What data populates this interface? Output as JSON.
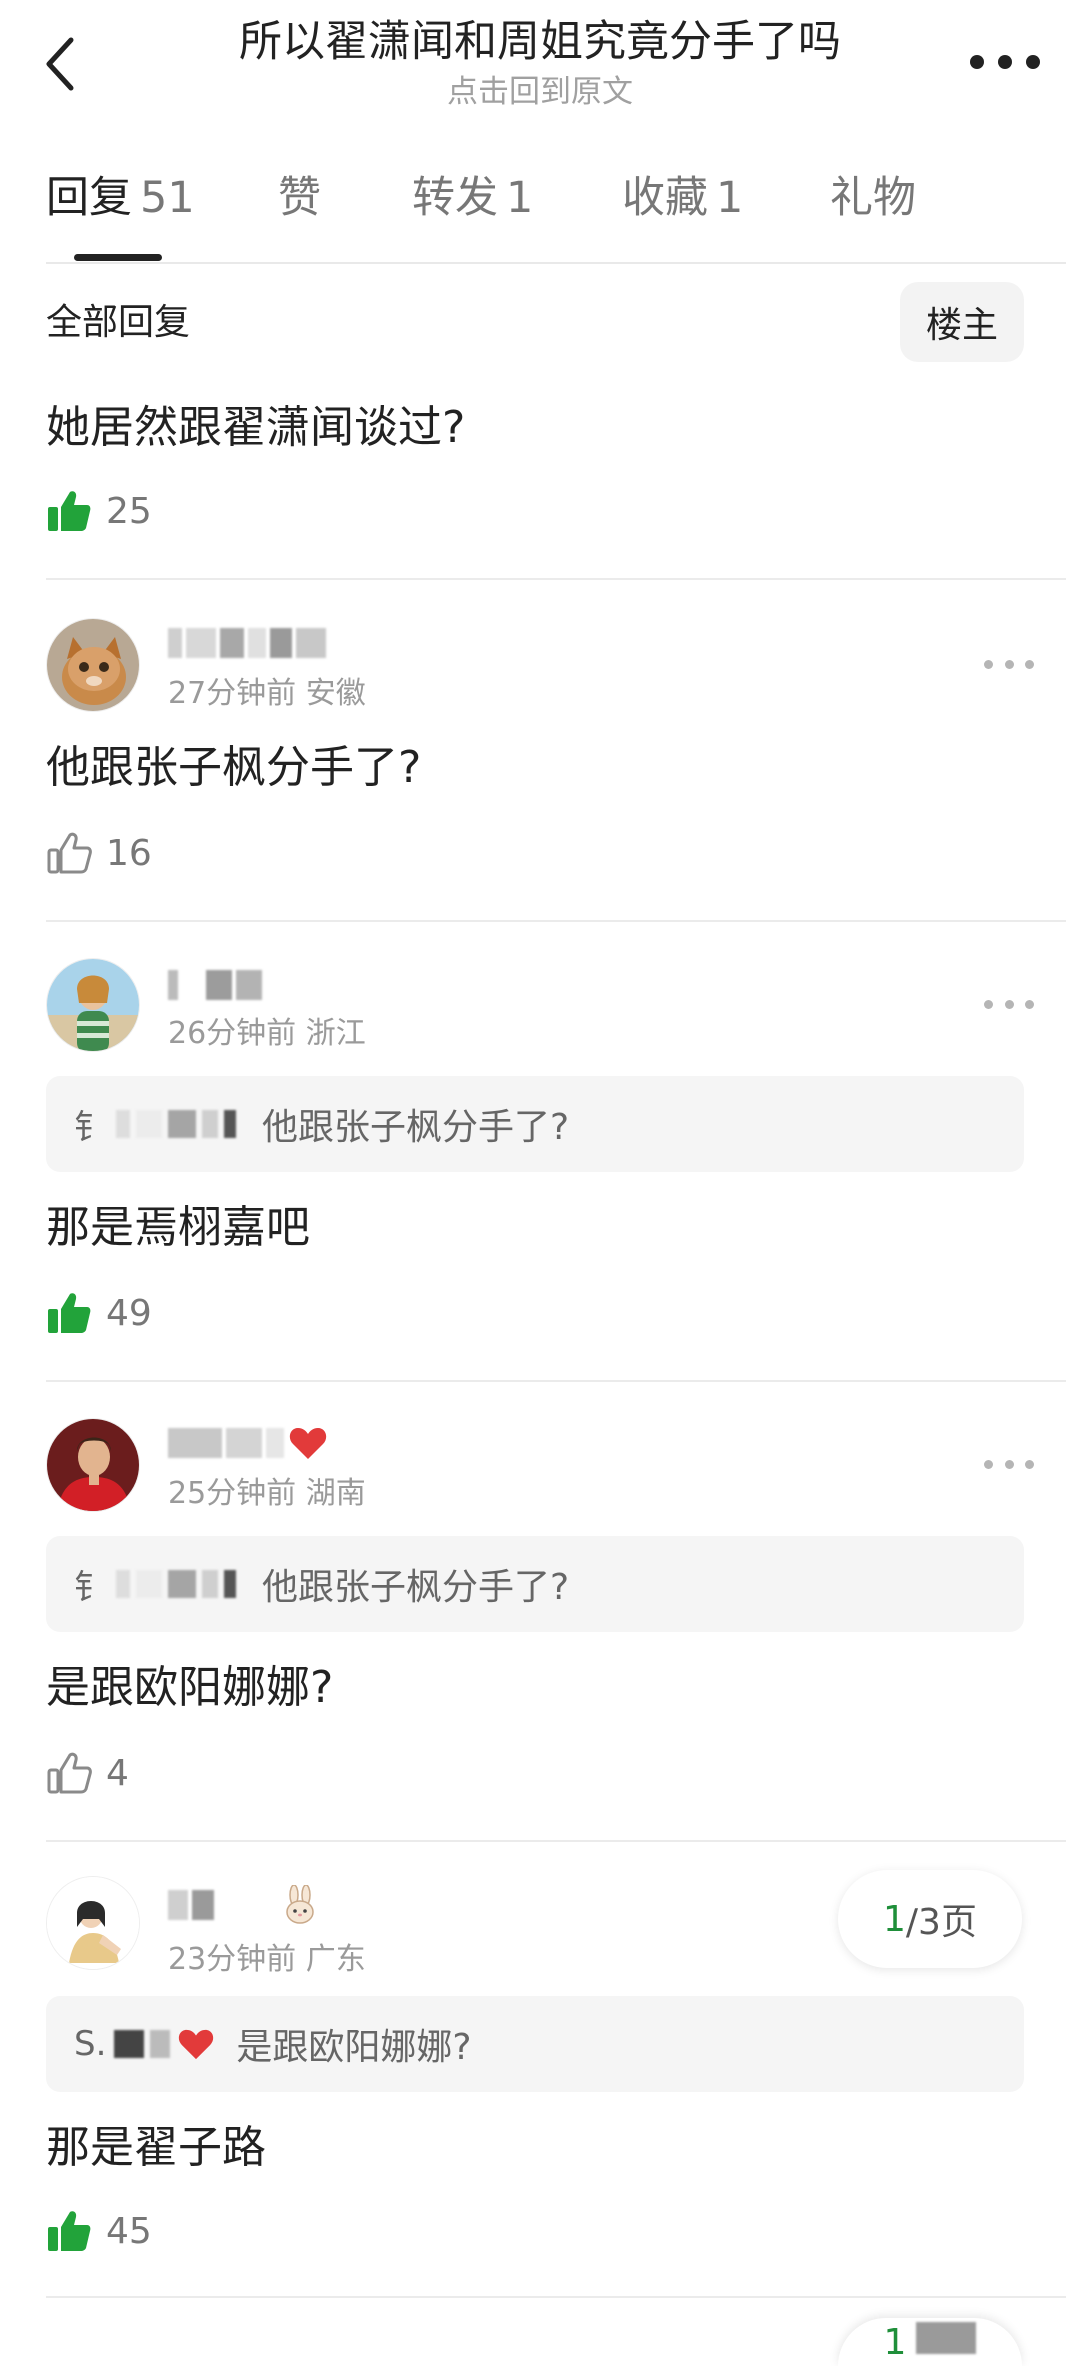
{
  "header": {
    "title": "所以翟潇闻和周姐究竟分手了吗",
    "subtitle": "点击回到原文"
  },
  "tabs": [
    {
      "label": "回复",
      "count": "51"
    },
    {
      "label": "赞",
      "count": ""
    },
    {
      "label": "转发",
      "count": "1"
    },
    {
      "label": "收藏",
      "count": "1"
    },
    {
      "label": "礼物",
      "count": ""
    }
  ],
  "filter": {
    "all_replies": "全部回复",
    "op_button": "楼主"
  },
  "top_reply": {
    "text": "她居然跟翟潇闻谈过?",
    "likes": "25",
    "liked": true
  },
  "replies": [
    {
      "meta": "27分钟前 安徽",
      "quote_initial": "",
      "quote_text": "",
      "text": "他跟张子枫分手了?",
      "likes": "16",
      "liked": false
    },
    {
      "meta": "26分钟前 浙江",
      "quote_initial": "钅",
      "quote_text": "他跟张子枫分手了?",
      "text": "那是焉栩嘉吧",
      "likes": "49",
      "liked": true
    },
    {
      "meta": "25分钟前 湖南",
      "quote_initial": "钅",
      "quote_text": "他跟张子枫分手了?",
      "text": "是跟欧阳娜娜?",
      "likes": "4",
      "liked": false
    },
    {
      "meta": "23分钟前 广东",
      "quote_initial": "S.",
      "quote_text": "是跟欧阳娜娜?",
      "text": "那是翟子路",
      "likes": "45",
      "liked": true
    }
  ],
  "pager": {
    "current": "1",
    "total": "/3页",
    "bottom_current": "1"
  },
  "colors": {
    "liked_green": "#22a33a",
    "unliked_gray": "#8a8a8a",
    "pager_green": "#1f8f3a"
  },
  "icons": [
    "back-arrow-icon",
    "more-icon",
    "thumbs-up-icon",
    "ellipsis-icon",
    "heart-icon",
    "rabbit-icon"
  ]
}
